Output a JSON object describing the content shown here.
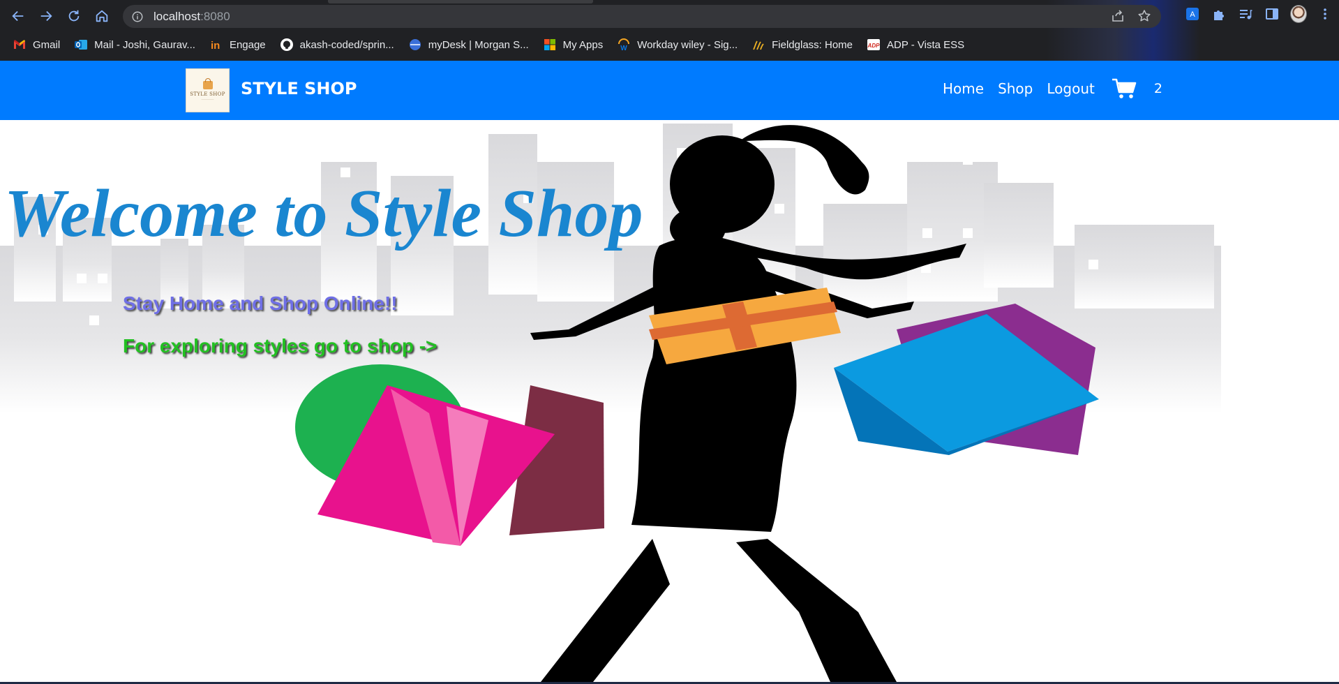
{
  "browser": {
    "url_host": "localhost",
    "url_port": ":8080",
    "bookmarks": [
      {
        "label": "Gmail",
        "icon": "gmail-icon"
      },
      {
        "label": "Mail - Joshi, Gaurav...",
        "icon": "outlook-icon"
      },
      {
        "label": "Engage",
        "icon": "engage-icon"
      },
      {
        "label": "akash-coded/sprin...",
        "icon": "github-icon"
      },
      {
        "label": "myDesk | Morgan S...",
        "icon": "mydesk-icon"
      },
      {
        "label": "My Apps",
        "icon": "microsoft-icon"
      },
      {
        "label": "Workday wiley - Sig...",
        "icon": "workday-icon"
      },
      {
        "label": "Fieldglass: Home",
        "icon": "fieldglass-icon"
      },
      {
        "label": "ADP - Vista ESS",
        "icon": "adp-icon"
      }
    ]
  },
  "navbar": {
    "logo_text": "STYLE SHOP",
    "brand": "STYLE SHOP",
    "links": {
      "home": "Home",
      "shop": "Shop",
      "logout": "Logout"
    },
    "cart_count": "2",
    "color": "#007bff"
  },
  "hero": {
    "title": "Welcome to Style Shop",
    "subtitle": "Stay Home and Shop Online!!",
    "cta": "For exploring styles go to shop ->",
    "title_color": "#1a86d0",
    "subtitle_color": "#6f6fe6",
    "cta_color": "#22c022"
  }
}
